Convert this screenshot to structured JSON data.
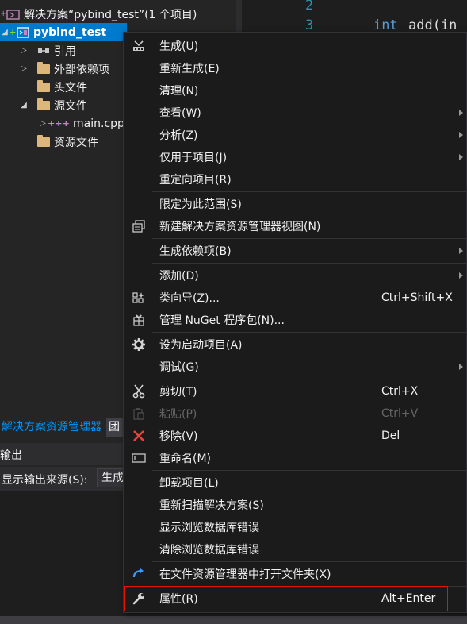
{
  "solution_explorer": {
    "solution_label": "解决方案“pybind_test”(1 个项目)",
    "project_label": "pybind_test",
    "references_label": "引用",
    "external_deps_label": "外部依赖项",
    "header_files_label": "头文件",
    "source_files_label": "源文件",
    "main_cpp_label": "main.cpp",
    "resource_files_label": "资源文件"
  },
  "editor": {
    "line2_num": "2",
    "line3_num": "3",
    "line3_keyword": "int",
    "line3_code": "add(in"
  },
  "bottom_panes": {
    "explorer_tab_label": "解决方案资源管理器",
    "second_tab_label": "团",
    "output_title": "输出",
    "output_source_label": "显示输出来源(S):",
    "output_source_value": "生成"
  },
  "context_menu": {
    "build": {
      "label": "生成(U)"
    },
    "rebuild": {
      "label": "重新生成(E)"
    },
    "clean": {
      "label": "清理(N)"
    },
    "view": {
      "label": "查看(W)"
    },
    "analyze": {
      "label": "分析(Z)"
    },
    "project_only": {
      "label": "仅用于项目(J)"
    },
    "retarget": {
      "label": "重定向项目(R)"
    },
    "scope_to_this": {
      "label": "限定为此范围(S)"
    },
    "new_explorer_view": {
      "label": "新建解决方案资源管理器视图(N)"
    },
    "build_dependencies": {
      "label": "生成依赖项(B)"
    },
    "add": {
      "label": "添加(D)"
    },
    "class_wizard": {
      "label": "类向导(Z)...",
      "shortcut": "Ctrl+Shift+X"
    },
    "manage_nuget": {
      "label": "管理 NuGet 程序包(N)..."
    },
    "set_startup": {
      "label": "设为启动项目(A)"
    },
    "debug": {
      "label": "调试(G)"
    },
    "cut": {
      "label": "剪切(T)",
      "shortcut": "Ctrl+X"
    },
    "paste": {
      "label": "粘贴(P)",
      "shortcut": "Ctrl+V"
    },
    "remove": {
      "label": "移除(V)",
      "shortcut": "Del"
    },
    "rename": {
      "label": "重命名(M)"
    },
    "unload": {
      "label": "卸载项目(L)"
    },
    "rescan": {
      "label": "重新扫描解决方案(S)"
    },
    "show_db_errors": {
      "label": "显示浏览数据库错误"
    },
    "clear_db_errors": {
      "label": "清除浏览数据库错误"
    },
    "open_in_explorer": {
      "label": "在文件资源管理器中打开文件夹(X)"
    },
    "properties": {
      "label": "属性(R)",
      "shortcut": "Alt+Enter"
    }
  },
  "colors": {
    "accent": "#007acc",
    "menu_background": "#1b1b1c",
    "highlight_border": "#e51400",
    "remove_icon": "#e8453c",
    "open_folder_icon": "#3b9cff"
  },
  "icons": {
    "build": "build-icon",
    "new_view": "new-view-icon",
    "class_wizard": "class-wizard-icon",
    "nuget": "nuget-package-icon",
    "startup": "gear-icon",
    "cut": "scissors-icon",
    "paste": "clipboard-icon",
    "remove": "close-icon",
    "rename": "rename-icon",
    "open_folder": "refresh-arrow-icon",
    "properties": "wrench-icon"
  }
}
